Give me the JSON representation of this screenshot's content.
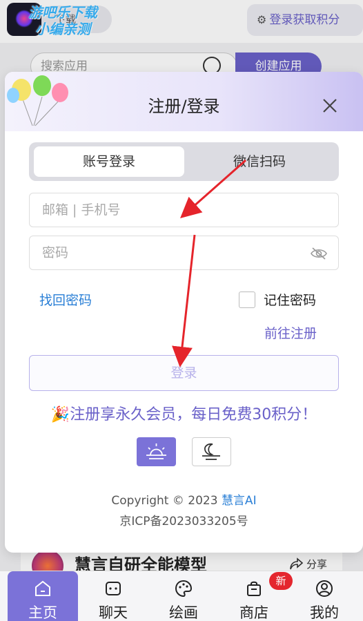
{
  "background": {
    "watermark_line1": "游吧乐下载",
    "watermark_line2": "小编亲测",
    "pill_btn_label": "下载",
    "login_points_label": "登录获取积分",
    "search_placeholder": "搜索应用",
    "create_app_label": "创建应用",
    "feed_title": "慧言自研全能模型",
    "share_label": "分享"
  },
  "modal": {
    "title": "注册/登录",
    "tabs": [
      {
        "label": "账号登录",
        "selected": true
      },
      {
        "label": "微信扫码",
        "selected": false
      }
    ],
    "account_placeholder": "邮箱 | 手机号",
    "password_placeholder": "密码",
    "forgot_label": "找回密码",
    "remember_label": "记住密码",
    "goto_register_label": "前往注册",
    "login_button_label": "登录",
    "promo_icon": "🎉",
    "promo_text": "注册享永久会员，每日免费30积分！",
    "copyright_text": "Copyright © 2023 ",
    "brand_name": "慧言AI",
    "icp": "京ICP备2023033205号"
  },
  "tabbar": {
    "items": [
      {
        "label": "主页",
        "icon": "home-icon",
        "active": true
      },
      {
        "label": "聊天",
        "icon": "chat-icon",
        "active": false
      },
      {
        "label": "绘画",
        "icon": "palette-icon",
        "active": false
      },
      {
        "label": "商店",
        "icon": "shop-bag-icon",
        "active": false
      },
      {
        "label": "我的",
        "icon": "user-icon",
        "active": false
      }
    ],
    "shop_badge": "新"
  },
  "colors": {
    "accent": "#6a61c9",
    "link": "#2a7fd6",
    "annotation_arrow": "#e5242b"
  }
}
